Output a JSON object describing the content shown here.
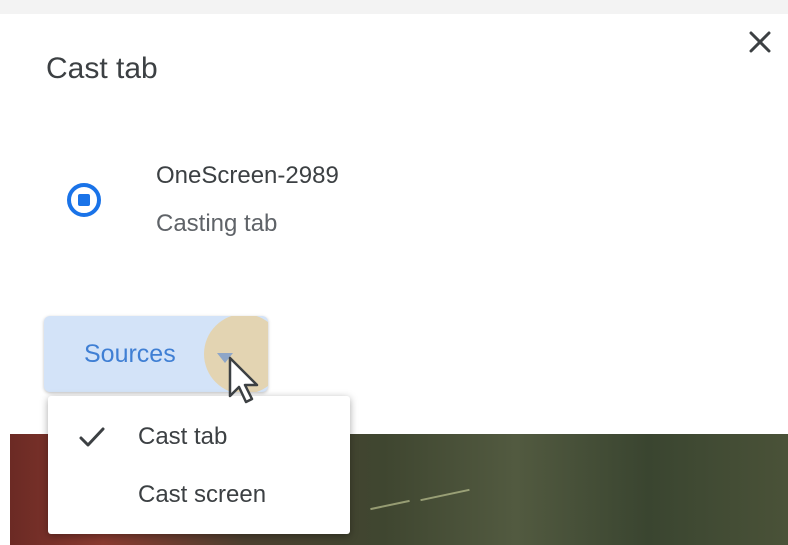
{
  "dialog": {
    "title": "Cast tab",
    "close_icon": "close-icon"
  },
  "device": {
    "name": "OneScreen-2989",
    "status": "Casting tab",
    "icon": "stop-cast-icon",
    "accent_color": "#1a73e8"
  },
  "sources": {
    "label": "Sources",
    "label_color": "#3f7fd4",
    "button_color": "#d3e3f8",
    "dropdown_icon": "dropdown-arrow-icon",
    "menu": {
      "items": [
        {
          "label": "Cast tab",
          "selected": true,
          "icon": "check-icon"
        },
        {
          "label": "Cast screen",
          "selected": false
        }
      ]
    }
  }
}
